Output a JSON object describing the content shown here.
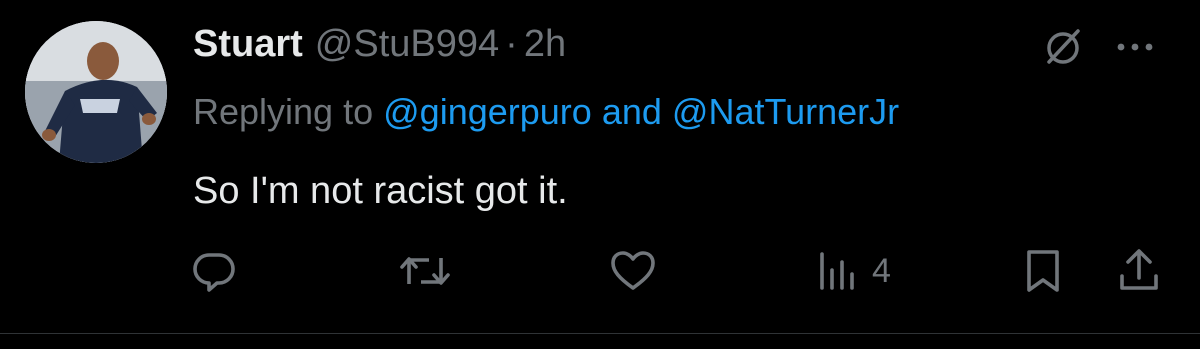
{
  "tweet": {
    "display_name": "Stuart",
    "handle": "@StuB994",
    "separator": "·",
    "time": "2h",
    "replying_prefix": "Replying to",
    "mention_1": "@gingerpuro",
    "replying_and": "and",
    "mention_2": "@NatTurnerJr",
    "text": "So I'm not racist got it.",
    "views_count": "4"
  },
  "icons": {
    "grok": "grok-slash-icon",
    "more": "more-dots-icon",
    "reply": "reply-icon",
    "retweet": "retweet-icon",
    "like": "like-icon",
    "views": "views-icon",
    "bookmark": "bookmark-icon",
    "share": "share-icon"
  },
  "colors": {
    "background": "#000000",
    "text": "#e7e9ea",
    "secondary": "#71767b",
    "link": "#1d9bf0"
  }
}
